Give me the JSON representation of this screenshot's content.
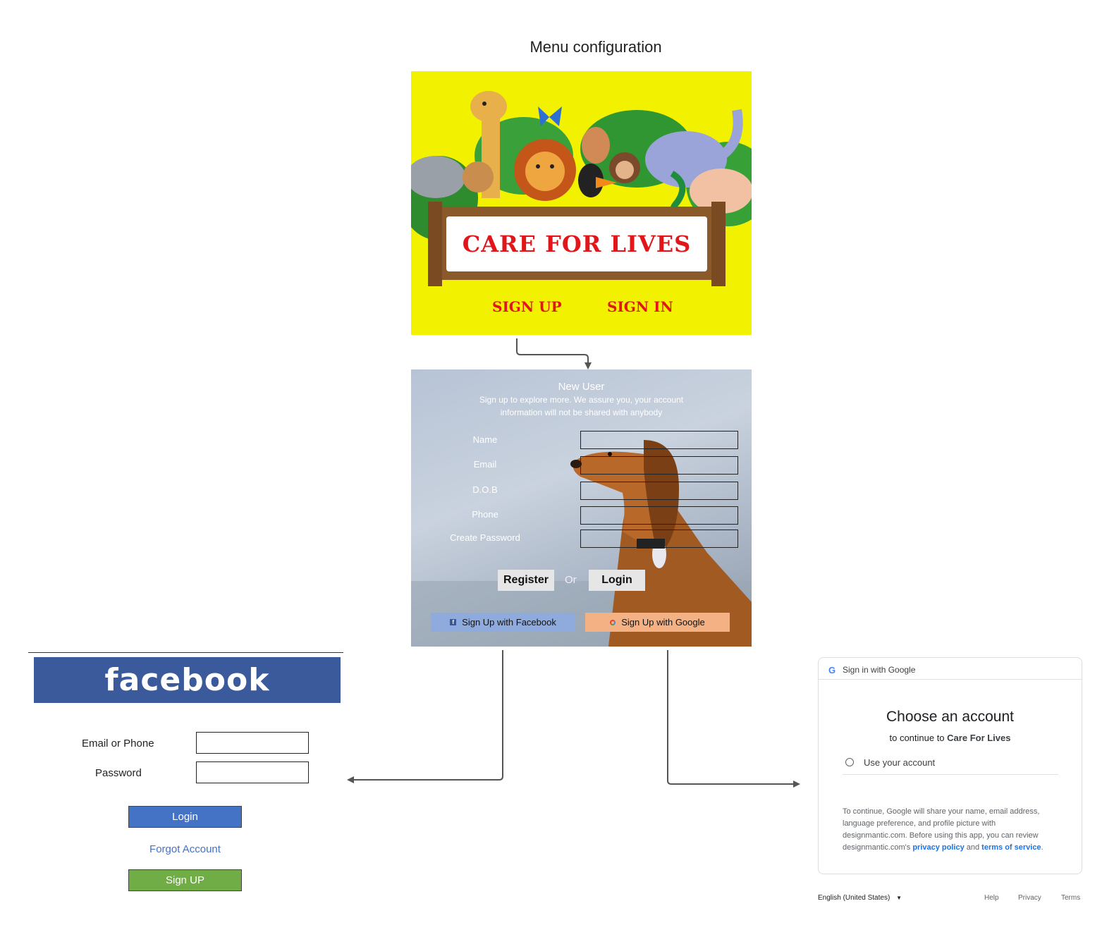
{
  "diagram": {
    "title": "Menu configuration"
  },
  "menu": {
    "banner_title": "CARE FOR LIVES",
    "sign_up": "SIGN UP",
    "sign_in": "SIGN IN",
    "colors": {
      "background": "#f2f200",
      "text": "#e0161a"
    }
  },
  "register": {
    "heading": "New User",
    "subtitle_line1": "Sign up to explore more. We assure you, your account",
    "subtitle_line2": "information will not be shared with anybody",
    "fields": [
      {
        "label": "Name",
        "value": ""
      },
      {
        "label": "Email",
        "value": ""
      },
      {
        "label": "D.O.B",
        "value": ""
      },
      {
        "label": "Phone",
        "value": ""
      },
      {
        "label": "Create Password",
        "value": ""
      }
    ],
    "register_label": "Register",
    "or_label": "Or",
    "login_label": "Login",
    "facebook_label": "Sign Up with Facebook",
    "google_label": "Sign Up with Google",
    "colors": {
      "facebook": "#8faadc",
      "google": "#f4b183"
    }
  },
  "facebook": {
    "logo_text": "facebook",
    "email_label": "Email or Phone",
    "email_value": "",
    "password_label": "Password",
    "password_value": "",
    "login_label": "Login",
    "forgot_label": "Forgot Account",
    "signup_label": "Sign UP",
    "colors": {
      "header": "#3a5a9b",
      "login": "#4472c4",
      "signup": "#70ad47",
      "link": "#4472c4"
    }
  },
  "google": {
    "header": "Sign in with Google",
    "title": "Choose an account",
    "continue_prefix": "to continue to",
    "continue_app": "Care For Lives",
    "use_account": "Use your account",
    "disclaimer_line1": "To continue, Google will share your name, email address,",
    "disclaimer_line2": "language preference, and profile picture with",
    "disclaimer_line3": "designmantic.com. Before using this app, you can review",
    "disclaimer_line4_prefix": "designmantic.com's",
    "privacy_policy": "privacy policy",
    "and_text": "and",
    "terms_of_service": "terms of service",
    "period": ".",
    "language": "English (United States)",
    "help": "Help",
    "privacy": "Privacy",
    "terms": "Terms",
    "colors": {
      "link": "#1a73e8"
    }
  }
}
